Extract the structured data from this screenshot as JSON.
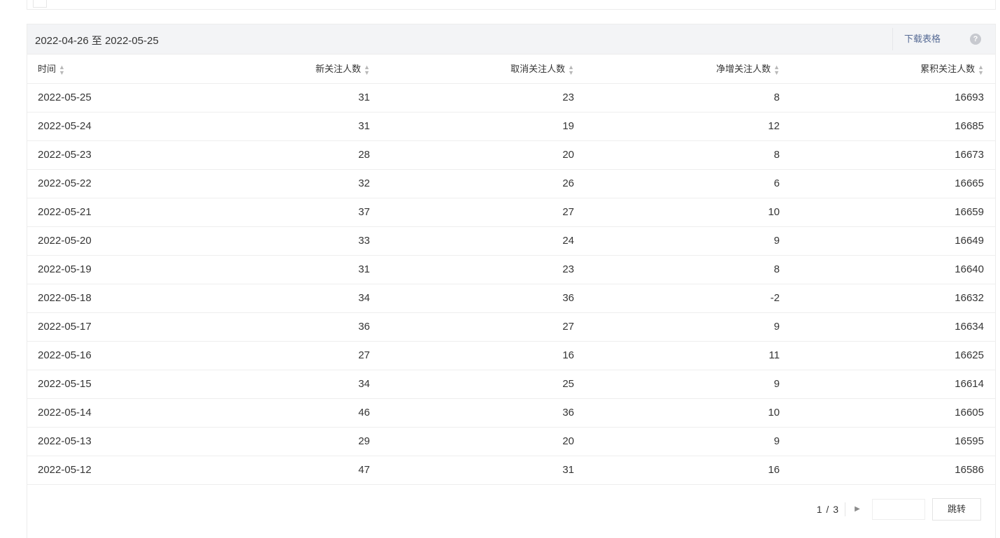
{
  "header": {
    "date_range": "2022-04-26 至 2022-05-25",
    "download_label": "下载表格",
    "help_icon": "question-circle-icon"
  },
  "table": {
    "columns": [
      "时间",
      "新关注人数",
      "取消关注人数",
      "净增关注人数",
      "累积关注人数"
    ],
    "sort_icon": "sort-up-down-icon",
    "rows": [
      [
        "2022-05-25",
        "31",
        "23",
        "8",
        "16693"
      ],
      [
        "2022-05-24",
        "31",
        "19",
        "12",
        "16685"
      ],
      [
        "2022-05-23",
        "28",
        "20",
        "8",
        "16673"
      ],
      [
        "2022-05-22",
        "32",
        "26",
        "6",
        "16665"
      ],
      [
        "2022-05-21",
        "37",
        "27",
        "10",
        "16659"
      ],
      [
        "2022-05-20",
        "33",
        "24",
        "9",
        "16649"
      ],
      [
        "2022-05-19",
        "31",
        "23",
        "8",
        "16640"
      ],
      [
        "2022-05-18",
        "34",
        "36",
        "-2",
        "16632"
      ],
      [
        "2022-05-17",
        "36",
        "27",
        "9",
        "16634"
      ],
      [
        "2022-05-16",
        "27",
        "16",
        "11",
        "16625"
      ],
      [
        "2022-05-15",
        "34",
        "25",
        "9",
        "16614"
      ],
      [
        "2022-05-14",
        "46",
        "36",
        "10",
        "16605"
      ],
      [
        "2022-05-13",
        "29",
        "20",
        "9",
        "16595"
      ],
      [
        "2022-05-12",
        "47",
        "31",
        "16",
        "16586"
      ]
    ]
  },
  "pagination": {
    "page_text": "1 / 3",
    "next_icon": "caret-right-icon",
    "page_input_value": "",
    "jump_label": "跳转"
  }
}
